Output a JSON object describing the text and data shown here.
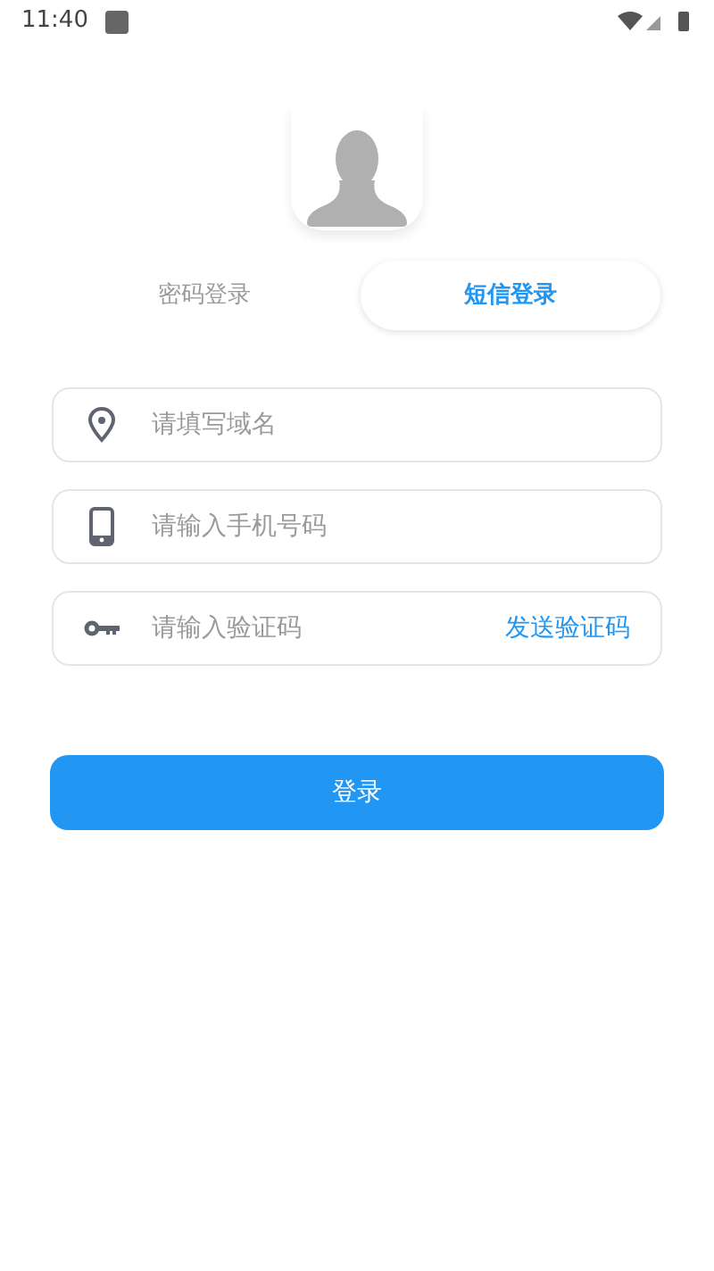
{
  "status_bar": {
    "time": "11:40"
  },
  "tabs": [
    {
      "label": "密码登录",
      "selected": false
    },
    {
      "label": "短信登录",
      "selected": true
    }
  ],
  "fields": [
    {
      "kind": "location",
      "placeholder": "请填写域名"
    },
    {
      "kind": "phone",
      "placeholder": "请输入手机号码"
    },
    {
      "kind": "key",
      "placeholder": "请输入验证码",
      "action": "发送验证码"
    }
  ],
  "login_button": "登录"
}
